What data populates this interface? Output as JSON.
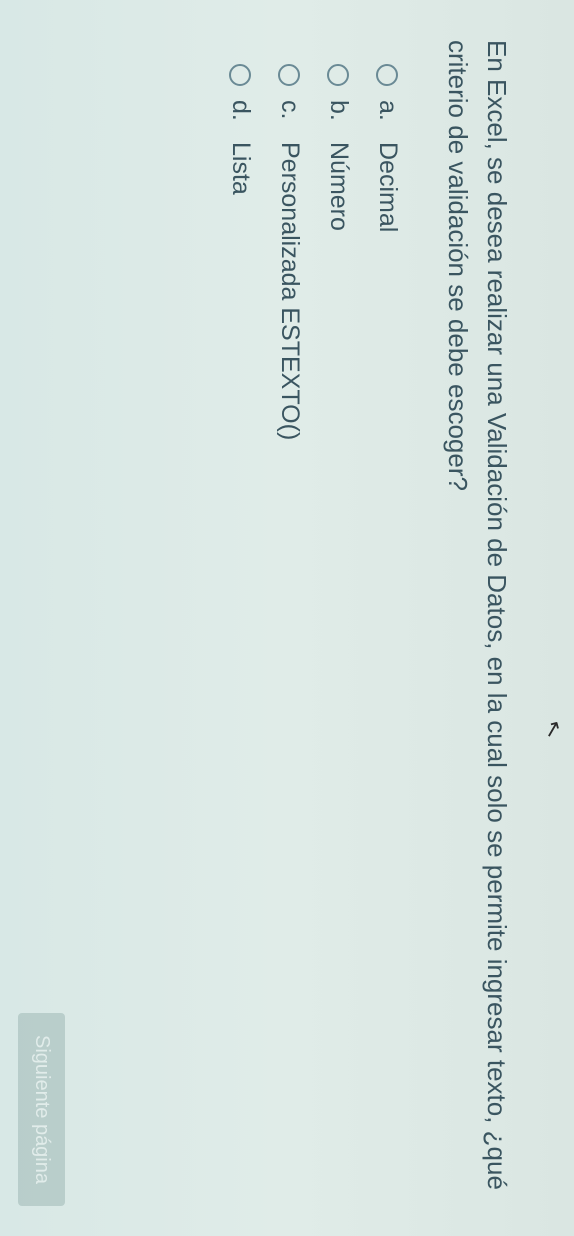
{
  "cursor_glyph": "↖",
  "top_right_text": "",
  "question": "En Excel, se desea realizar una Validación de Datos, en la cual solo se permite ingresar texto, ¿qué criterio de validación se debe escoger?",
  "options": [
    {
      "letter": "a.",
      "label": "Decimal"
    },
    {
      "letter": "b.",
      "label": "Número"
    },
    {
      "letter": "c.",
      "label": "Personalizada ESTEXTO()"
    },
    {
      "letter": "d.",
      "label": "Lista"
    }
  ],
  "next_button": "Siguiente página"
}
